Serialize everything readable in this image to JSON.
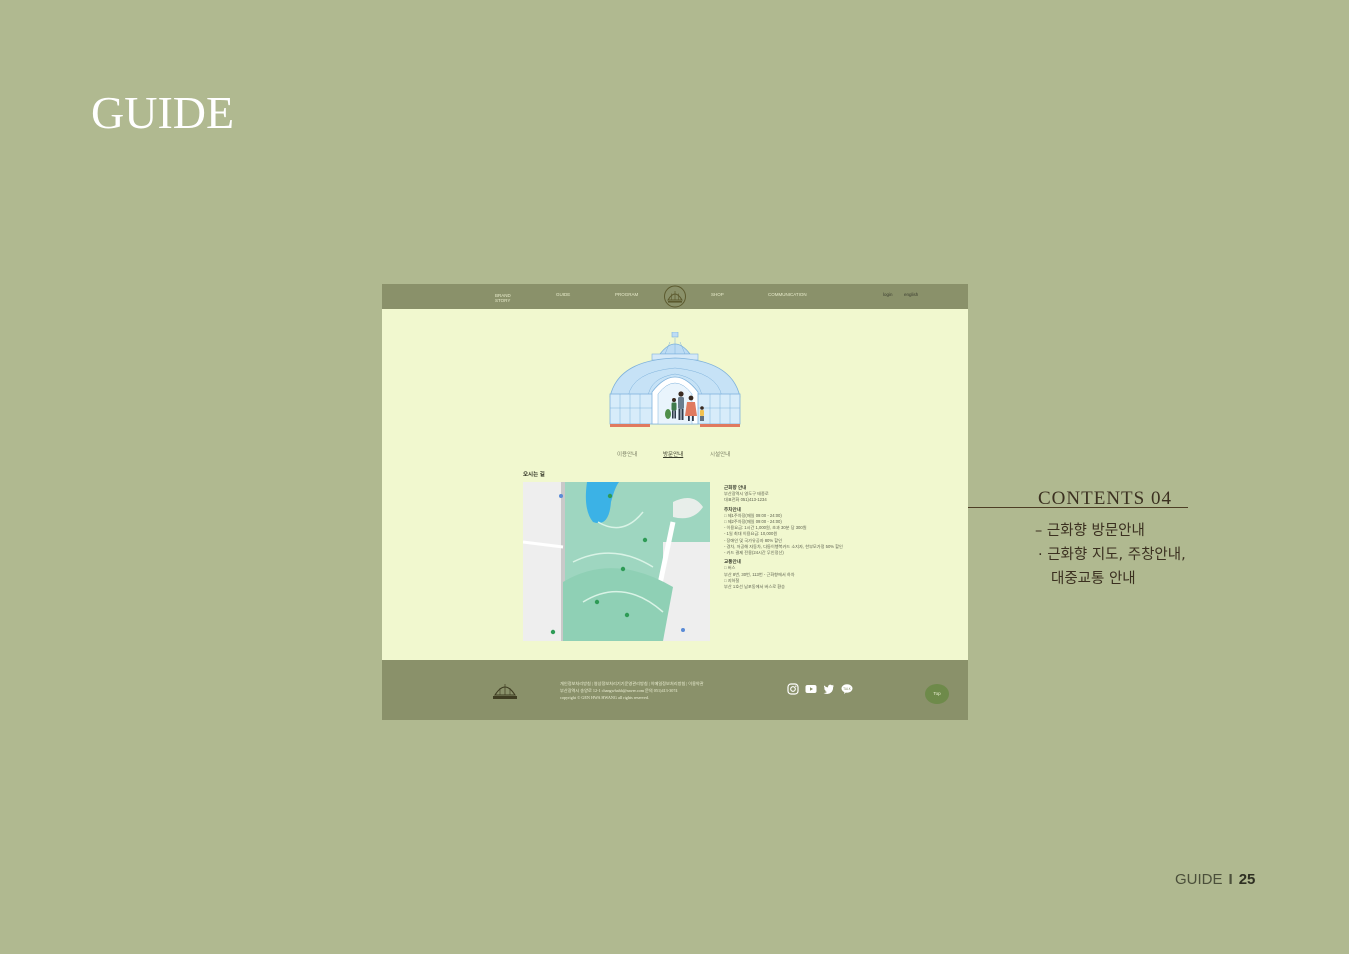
{
  "page": {
    "title": "GUIDE",
    "footer_section": "GUIDE",
    "footer_separator": "I",
    "footer_page_number": "25"
  },
  "mockup": {
    "nav": {
      "items": [
        {
          "label": "BRAND\nSTORY"
        },
        {
          "label": "GUIDE"
        },
        {
          "label": "PROGRAM"
        },
        {
          "label": "SHOP"
        },
        {
          "label": "COMMUNICATION"
        }
      ],
      "login": "login",
      "english": "english",
      "logo_icon": "greenhouse-logo-icon"
    },
    "subtabs": [
      {
        "label": "이용안내"
      },
      {
        "label": "방문안내",
        "active": true
      },
      {
        "label": "시설안내"
      }
    ],
    "section_label": "오시는 길",
    "info": {
      "place_head": "근화향 안내",
      "address": "부산광역시 영도구 태종로",
      "phone": "대표전화 051)413-1234",
      "parking_head": "주차안내",
      "parking_lines": [
        "□ 제1주차장(매일 09:00 - 24:00)",
        "□ 제2주차장(매일 09:00 - 24:00)",
        "- 이용요금: 1시간 1,000원, 초과 30분 당 300원",
        "- 1일 최대 이용요금: 10,000원",
        "- 장애인 및 국가유공자 80% 할인",
        "- 경차, 저공해 자동차, 다둥이행복카드 소지자, 한부모가정 50% 할인",
        "- 카드 결제 전용(24시간 무인정산)"
      ],
      "transit_head": "교통안내",
      "transit_lines": [
        "□ 버스",
        "부산 8번, 30번, 113번 - 근화향에서 하차",
        "□ 지하철",
        "부산 1호선 남포동에서 버스로 환승"
      ]
    },
    "footer": {
      "links": "개인정보처리방침  |  영상정보처리기기운영관리방침  |  이메일정보처리방침  |  이용약관",
      "address": "부산광역시 송양로 12-1 changwhahh@naver.com 문의 051)413-3074",
      "copyright": "copyright © GEN HWA HWANG all rights reserved.",
      "social_icons": [
        "instagram-icon",
        "youtube-icon",
        "twitter-icon",
        "kakaotalk-icon"
      ],
      "top_label": "Top"
    }
  },
  "contents": {
    "heading": "CONTENTS 04",
    "items": [
      "– 근화향 방문안내",
      "· 근화향 지도, 주창안내,",
      "대중교통 안내"
    ]
  },
  "colors": {
    "background": "#b0b990",
    "mock_bg": "#f1f8cf",
    "mock_bar": "#8a916a",
    "heading_text": "#3b3020"
  }
}
